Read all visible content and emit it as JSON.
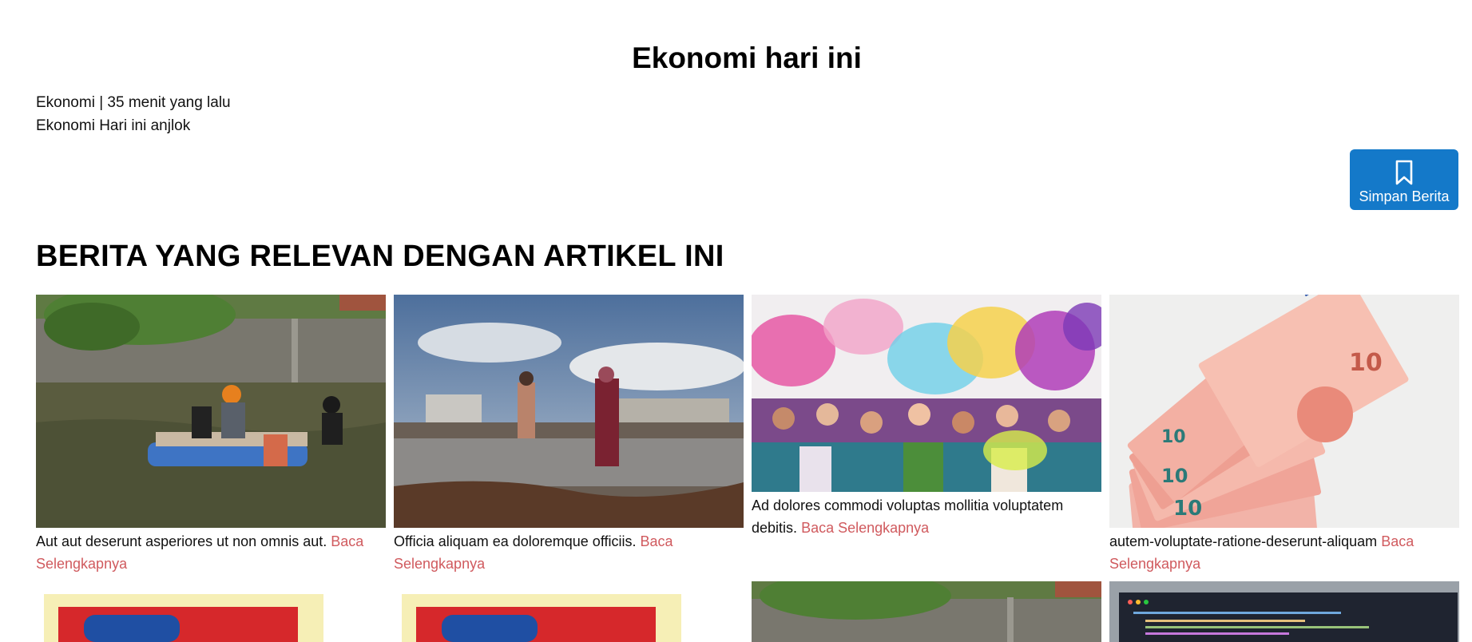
{
  "article": {
    "title": "Ekonomi hari ini",
    "meta_line": "Ekonomi | 35 menit yang lalu",
    "body_line": "Ekonomi Hari ini anjlok"
  },
  "save_button": {
    "label": "Simpan Berita",
    "icon": "bookmark-icon",
    "color": "#1479c9"
  },
  "related": {
    "heading": "BERITA YANG RELEVAN DENGAN ARTIKEL INI",
    "link_color": "#d05a5e",
    "items": [
      {
        "caption": "Aut aut deserunt asperiores ut non omnis aut.",
        "link": "Baca Selengkapnya",
        "image": "flood-raft-photo"
      },
      {
        "caption": "Officia aliquam ea doloremque officiis.",
        "link": "Baca Selengkapnya",
        "image": "refugee-camp-photo"
      },
      {
        "caption": "Ad dolores commodi voluptas mollitia voluptatem debitis.",
        "link": "Baca Selengkapnya",
        "image": "color-festival-photo"
      },
      {
        "caption": "autem-voluptate-ratione-deserunt-aliquam",
        "link": "Baca Selengkapnya",
        "image": "euro-banknotes-photo"
      },
      {
        "caption": "",
        "link": "",
        "image": "snack-package-photo"
      },
      {
        "caption": "",
        "link": "",
        "image": "snack-package-photo"
      },
      {
        "caption": "",
        "link": "",
        "image": "flood-raft-photo"
      },
      {
        "caption": "",
        "link": "",
        "image": "code-editor-photo"
      }
    ]
  }
}
